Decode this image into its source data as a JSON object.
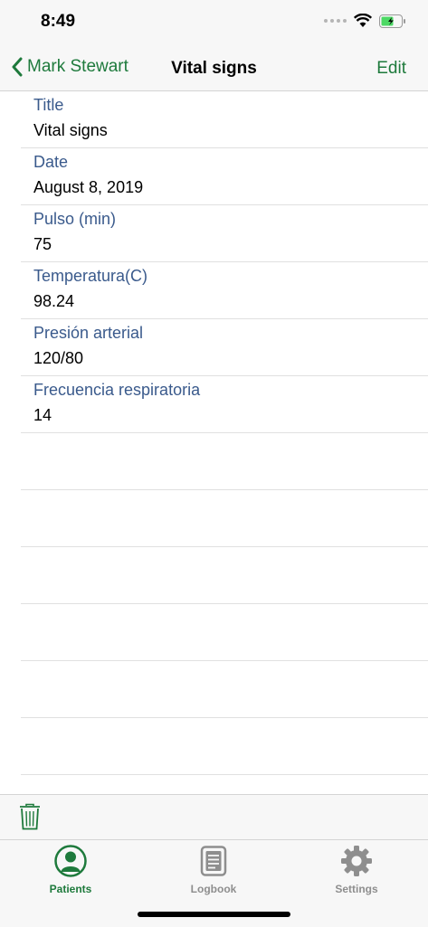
{
  "status_bar": {
    "time": "8:49"
  },
  "nav": {
    "back_label": "Mark Stewart",
    "title": "Vital signs",
    "edit_label": "Edit"
  },
  "fields": [
    {
      "label": "Title",
      "value": "Vital signs"
    },
    {
      "label": "Date",
      "value": "August 8, 2019"
    },
    {
      "label": "Pulso (min)",
      "value": "75"
    },
    {
      "label": "Temperatura(C)",
      "value": "98.24"
    },
    {
      "label": "Presión arterial",
      "value": "120/80"
    },
    {
      "label": "Frecuencia respiratoria",
      "value": "14"
    }
  ],
  "tabs": [
    {
      "label": "Patients",
      "icon": "person-icon",
      "active": true
    },
    {
      "label": "Logbook",
      "icon": "logbook-icon",
      "active": false
    },
    {
      "label": "Settings",
      "icon": "gear-icon",
      "active": false
    }
  ],
  "colors": {
    "accent": "#1e7a3c",
    "label": "#3a5a8c",
    "inactive": "#8e8e8e",
    "battery": "#4cd964"
  }
}
